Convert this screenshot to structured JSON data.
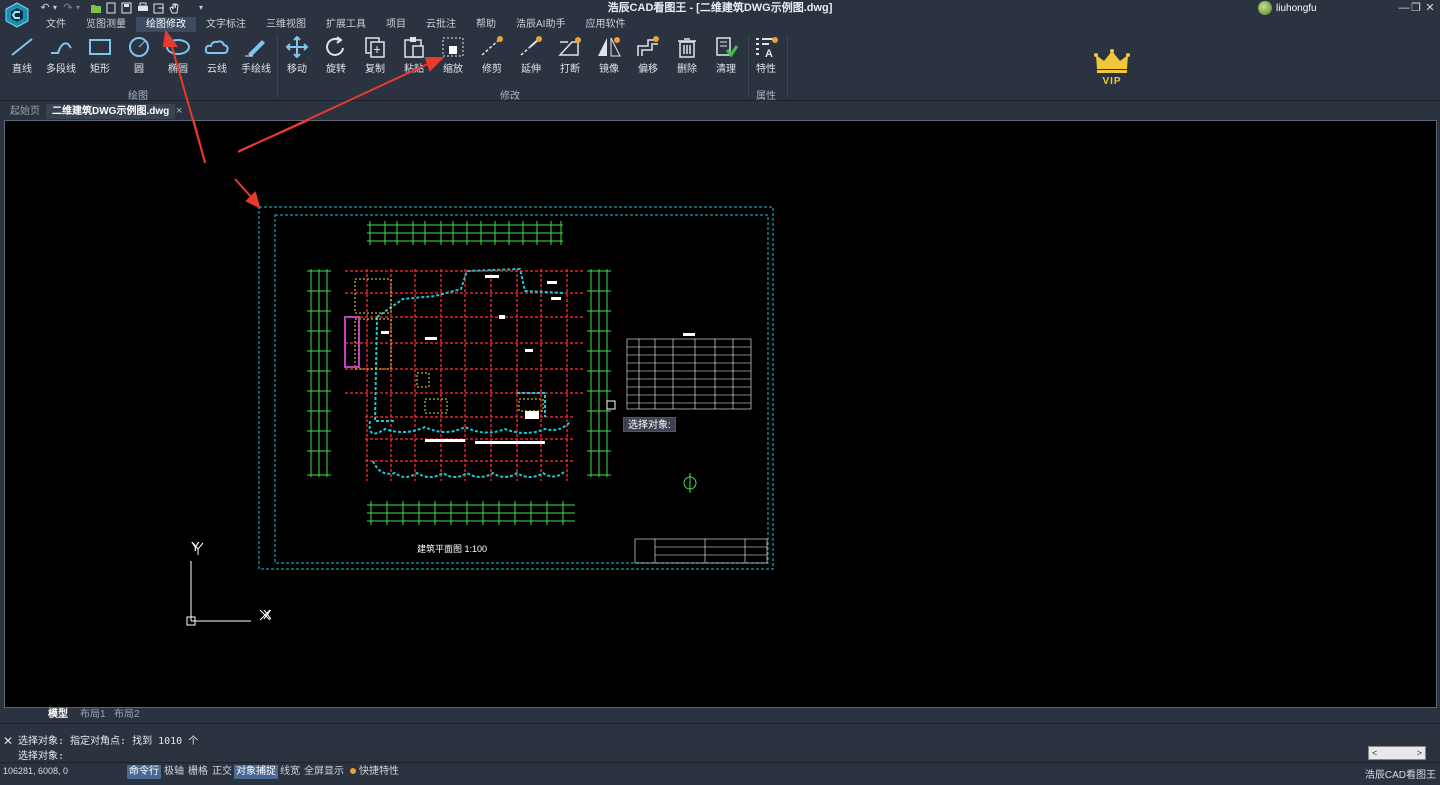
{
  "window": {
    "title": "浩辰CAD看图王 - [二维建筑DWG示例图.dwg]",
    "user": "liuhongfu",
    "minimize": "—",
    "restore": "❐",
    "close": "✕"
  },
  "quick_access": [
    "↶",
    "▾",
    "↷",
    "▾"
  ],
  "menu": [
    "文件",
    "览图测量",
    "绘图修改",
    "文字标注",
    "三维视图",
    "扩展工具",
    "项目",
    "云批注",
    "帮助",
    "浩辰AI助手",
    "应用软件"
  ],
  "menu_active": "绘图修改",
  "ribbon": {
    "draw_tools": [
      "直线",
      "多段线",
      "矩形",
      "圆",
      "椭圆",
      "云线",
      "手绘线"
    ],
    "draw_group": "绘图",
    "modify_tools": [
      "移动",
      "旋转",
      "复制",
      "粘贴",
      "缩放",
      "修剪",
      "延伸",
      "打断",
      "镜像",
      "偏移",
      "删除",
      "清理"
    ],
    "modify_group": "修改",
    "prop_tools": [
      "特性"
    ],
    "prop_group": "属性",
    "vip_label": "VIP"
  },
  "doc_tabs": [
    "起始页",
    "二维建筑DWG示例图.dwg"
  ],
  "doc_tab_close": "×",
  "canvas": {
    "tooltip": "选择对象:",
    "ucs_x": "X",
    "ucs_y": "Y",
    "drawing_caption": "建筑平面图  1:100"
  },
  "layout_tabs": [
    "模型",
    "布局1",
    "布局2"
  ],
  "command": {
    "line1": "选择对象: 指定对角点: 找到 1010 个",
    "line2": "选择对象:",
    "close": "✕",
    "scroll_left": "<",
    "scroll_right": ">"
  },
  "status": {
    "coords": "106281, 6008, 0",
    "buttons": [
      {
        "label": "命令行",
        "on": true
      },
      {
        "label": "极轴",
        "on": false
      },
      {
        "label": "栅格",
        "on": false
      },
      {
        "label": "正交",
        "on": false
      },
      {
        "label": "对象捕捉",
        "on": true
      },
      {
        "label": "线宽",
        "on": false
      },
      {
        "label": "全屏显示",
        "on": false
      }
    ],
    "quick_prop": "快捷特性",
    "brand": "浩辰CAD看图王"
  },
  "colors": {
    "bg": "#2b3340",
    "canvas": "#000000",
    "cyan": "#19c8d2",
    "green": "#3fe04a",
    "red": "#e0242c",
    "yellow": "#e6e637",
    "annotation_arrow": "#e83a2e",
    "gold": "#f2c838"
  }
}
